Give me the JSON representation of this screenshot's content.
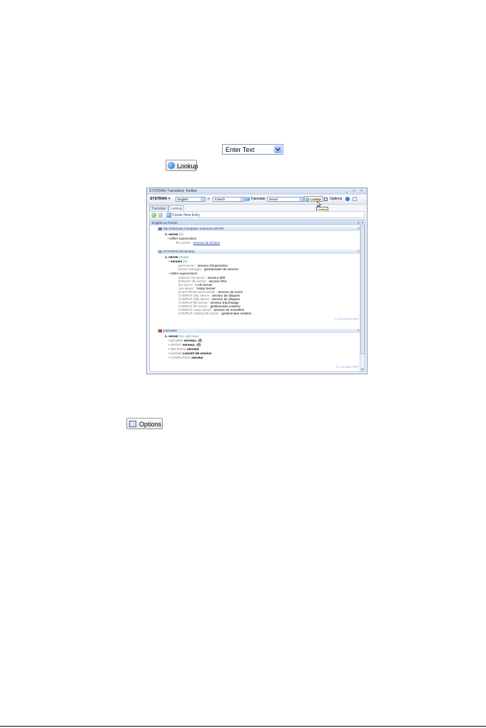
{
  "enter_text": {
    "label": "Enter Text"
  },
  "lookup_button": {
    "label": "Lookup"
  },
  "options_button": {
    "label": "Options"
  },
  "window": {
    "title": "SYSTRAN Translation Toolbar",
    "controls": "_ □ ×",
    "toolbar": {
      "brand": "SYSTRAN",
      "brand_arrow": "▾",
      "source_language": "English",
      "target_language": "French",
      "translate_label": "Translate",
      "lookup_query": "server",
      "lookup_label": "Lookup",
      "options_label": "Options",
      "help_label": "?"
    },
    "tooltip": "Lookup",
    "tabs": [
      "Translate",
      "Lookup"
    ],
    "create_entry_label": "Create New Entry",
    "pane_header": "English to French",
    "sections": [
      {
        "title": "My Dictionary Computer Sciences EN-FR",
        "entries": [
          {
            "id": "1. server",
            "pos": "(n)"
          },
          {
            "id": "• Other expressions:"
          },
          {
            "src": "file server :",
            "tgt": "serveur de fichiers"
          }
        ]
      },
      {
        "title": "SYSTRAN Dictionary",
        "head": "1. server",
        "head_pos": "(noun)",
        "main_sense": "serveur",
        "main_pos": "(n)",
        "examples": [
          {
            "src": "print server :",
            "tgt": "serveur d'impression"
          },
          {
            "src": "server manager :",
            "tgt": "gestionnaire du serveur"
          }
        ],
        "other_label": "Other expressions:",
        "other": [
          {
            "src": "INDUST tdi server :",
            "tgt": "serveur IDR"
          },
          {
            "src": "INDUST dfa server :",
            "tgt": "serveur RFA"
          },
          {
            "src": "lan server :",
            "tgt": "LAN Server"
          },
          {
            "src": "voe server :",
            "tgt": "Vstep Server"
          },
          {
            "src": "ELECTRON name server :",
            "tgt": "serveur de noms"
          },
          {
            "src": "COMPUT disc server :",
            "tgt": "serveur de disques"
          },
          {
            "src": "COMPUT disk server :",
            "tgt": "serveur de disques"
          },
          {
            "src": "COMPUT file server :",
            "tgt": "serveur d'archivage"
          },
          {
            "src": "COMPUT list server :",
            "tgt": "gestionnaire Listserv"
          },
          {
            "src": "COMPUT news server :",
            "tgt": "serveur de nouvelles"
          },
          {
            "src": "COMPUT mailing list server :",
            "tgt": "gestionnaire Listserv"
          }
        ],
        "copyright": "© SYSTRAN 2007"
      },
      {
        "title": "Larousse",
        "head": "1. server",
        "head_pos": "[sɜː vər] noun",
        "lines": [
          {
            "pre": "[at table]",
            "tgt": "serveur, -(f)"
          },
          {
            "pre": "SPORT",
            "tgt": "serveur, -(f)"
          },
          {
            "pre": "RELIGION",
            "tgt": "servant"
          },
          {
            "pre": "[utensil]",
            "tgt": "couvert de service"
          },
          {
            "pre": "COMPUTING",
            "tgt": "serveur"
          }
        ],
        "copyright": "© Larousse 2007"
      }
    ]
  }
}
